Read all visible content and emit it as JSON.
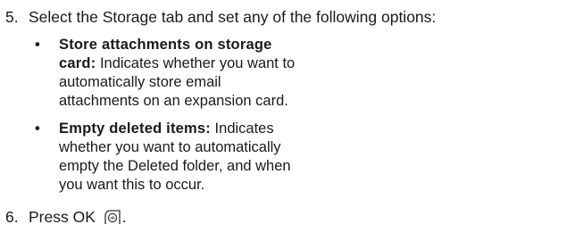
{
  "steps": [
    {
      "number": "5.",
      "text": "Select the Storage tab and set any of the following options:"
    },
    {
      "number": "6.",
      "text_before": "Press OK ",
      "text_after": ".",
      "icon": "ok-button-icon"
    }
  ],
  "options": [
    {
      "term": "Store attachments on storage card:",
      "description": " Indicates whether you want to automatically store email attachments on an expansion card."
    },
    {
      "term": "Empty deleted items:",
      "description": " Indicates whether you want to automatically empty the Deleted folder, and when you want this to occur."
    }
  ]
}
